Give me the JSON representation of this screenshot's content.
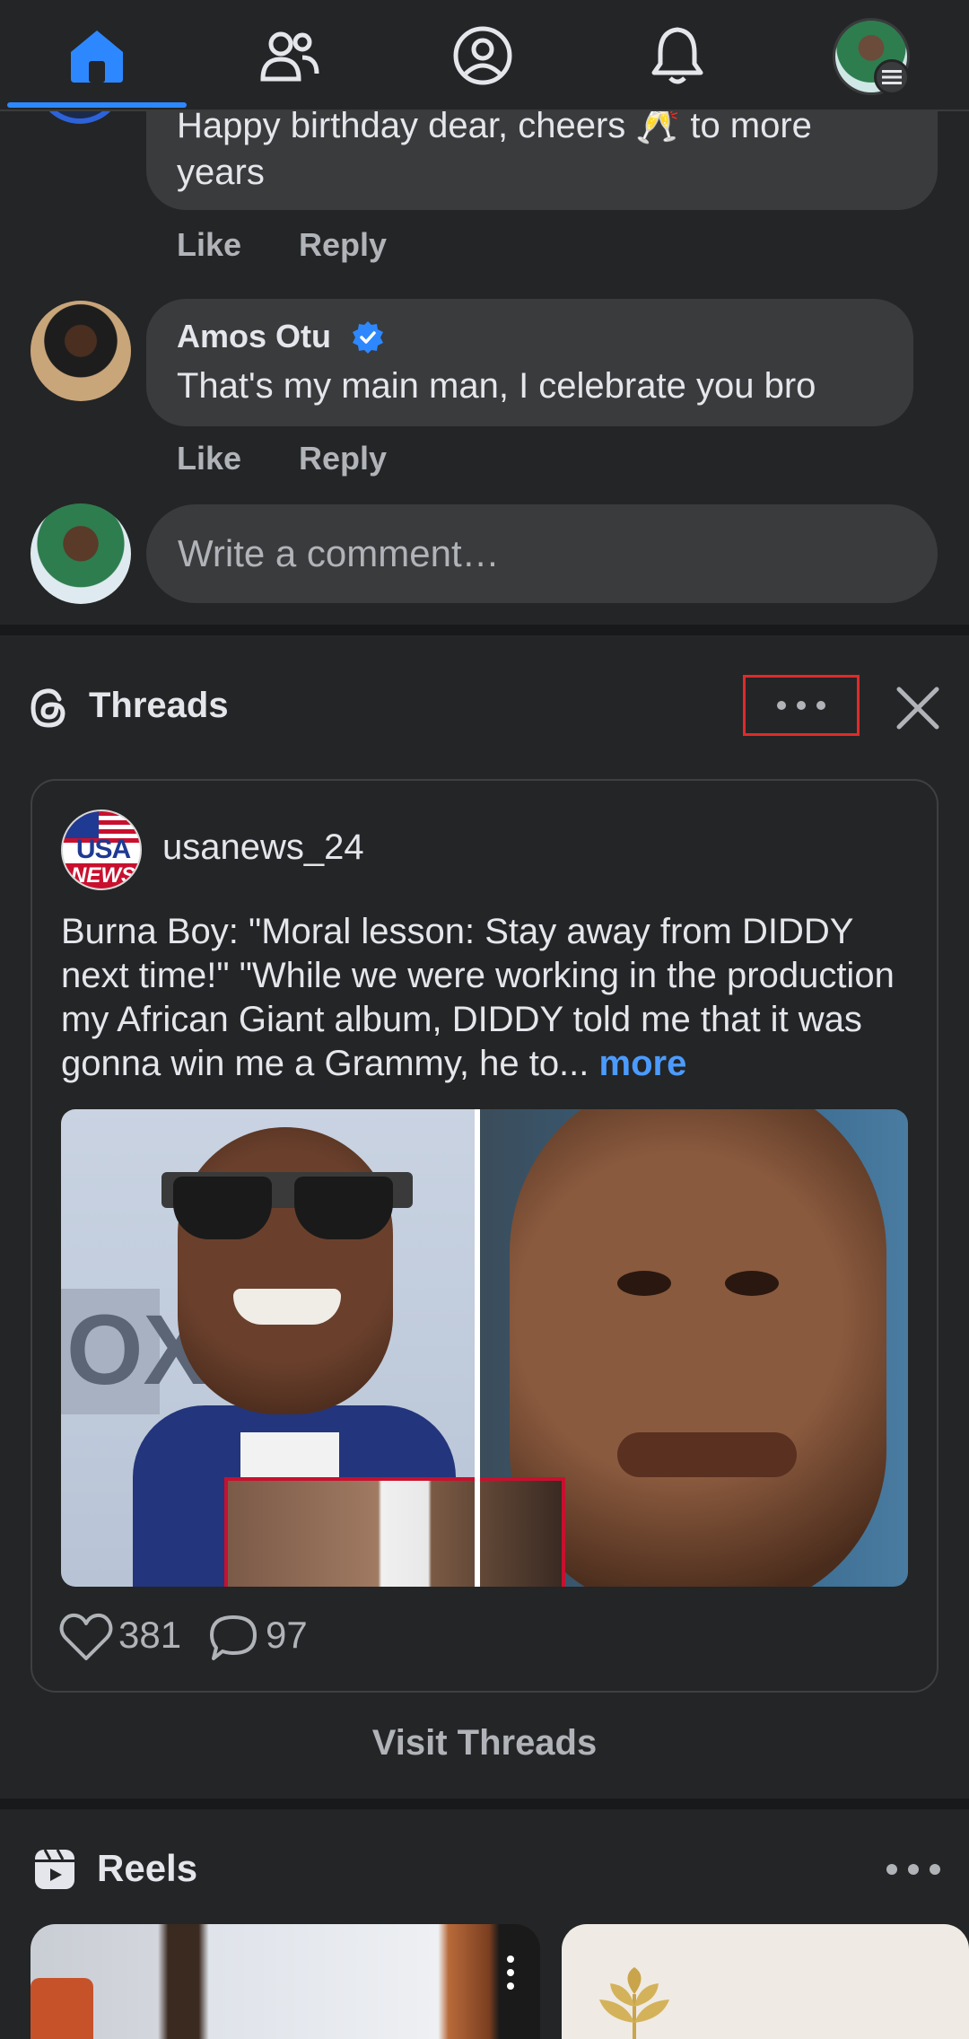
{
  "nav": {
    "items": [
      {
        "name": "home-icon",
        "active": true
      },
      {
        "name": "friends-icon",
        "active": false
      },
      {
        "name": "profile-icon",
        "active": false
      },
      {
        "name": "notifications-icon",
        "active": false
      }
    ],
    "accent": "#2d88ff"
  },
  "comments": [
    {
      "author": "",
      "text_line1": "Happy birthday dear, cheers 🥂 to more",
      "text_line2": "years",
      "like_label": "Like",
      "reply_label": "Reply"
    },
    {
      "author": "Amos Otu",
      "verified": true,
      "text": "That's my main man, I celebrate you bro",
      "like_label": "Like",
      "reply_label": "Reply"
    }
  ],
  "comment_input": {
    "placeholder": "Write a comment…"
  },
  "threads": {
    "section_title": "Threads",
    "post": {
      "username": "usanews_24",
      "avatar_text_top": "USA",
      "avatar_text_bottom": "NEWS",
      "body": "Burna Boy: \"Moral lesson: Stay away from DIDDY next time!\" \"While we were working in the production my African Giant album, DIDDY told me that  it was gonna win me a Grammy, he to...",
      "more_label": "more",
      "likes": "381",
      "comments": "97"
    },
    "visit_label": "Visit Threads"
  },
  "reels": {
    "section_title": "Reels"
  }
}
